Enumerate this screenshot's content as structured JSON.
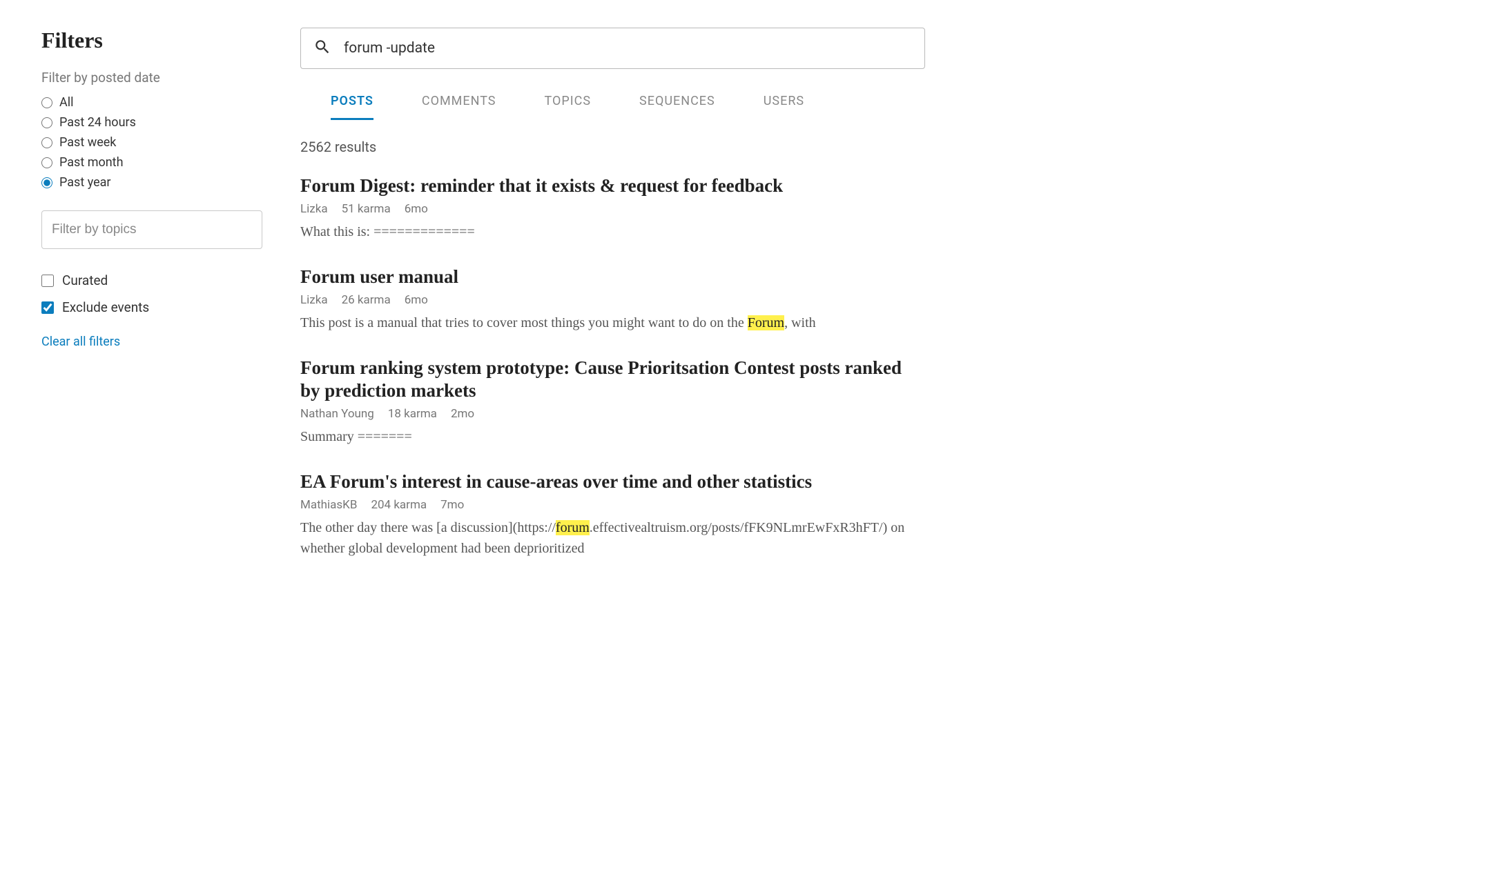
{
  "sidebar": {
    "title": "Filters",
    "dateFilter": {
      "label": "Filter by posted date",
      "options": [
        "All",
        "Past 24 hours",
        "Past week",
        "Past month",
        "Past year"
      ],
      "selected": "Past year"
    },
    "topicFilter": {
      "placeholder": "Filter by topics"
    },
    "checkboxes": [
      {
        "label": "Curated",
        "checked": false
      },
      {
        "label": "Exclude events",
        "checked": true
      }
    ],
    "clearLabel": "Clear all filters"
  },
  "search": {
    "query": "forum -update"
  },
  "tabs": [
    "POSTS",
    "COMMENTS",
    "TOPICS",
    "SEQUENCES",
    "USERS"
  ],
  "activeTab": "POSTS",
  "resultsCount": "2562 results",
  "results": [
    {
      "title": "Forum Digest: reminder that it exists & request for feedback",
      "author": "Lizka",
      "karma": "51 karma",
      "age": "6mo",
      "snippet": [
        [
          "text",
          "What this is: ============="
        ]
      ]
    },
    {
      "title": "Forum user manual",
      "author": "Lizka",
      "karma": "26 karma",
      "age": "6mo",
      "snippet": [
        [
          "text",
          "This post is a manual that tries to cover most things you might want to do on the "
        ],
        [
          "hl",
          "Forum"
        ],
        [
          "text",
          ", with"
        ]
      ]
    },
    {
      "title": "Forum ranking system prototype: Cause Prioritsation Contest posts ranked by prediction markets",
      "author": "Nathan Young",
      "karma": "18 karma",
      "age": "2mo",
      "snippet": [
        [
          "text",
          "Summary ======="
        ]
      ]
    },
    {
      "title": "EA Forum's interest in cause-areas over time and other statistics",
      "author": "MathiasKB",
      "karma": "204 karma",
      "age": "7mo",
      "snippet": [
        [
          "text",
          "The other day there was [a discussion](https://"
        ],
        [
          "hl",
          "forum"
        ],
        [
          "text",
          ".effectivealtruism.org/posts/fFK9NLmrEwFxR3hFT/) on whether global development had been deprioritized"
        ]
      ]
    }
  ]
}
